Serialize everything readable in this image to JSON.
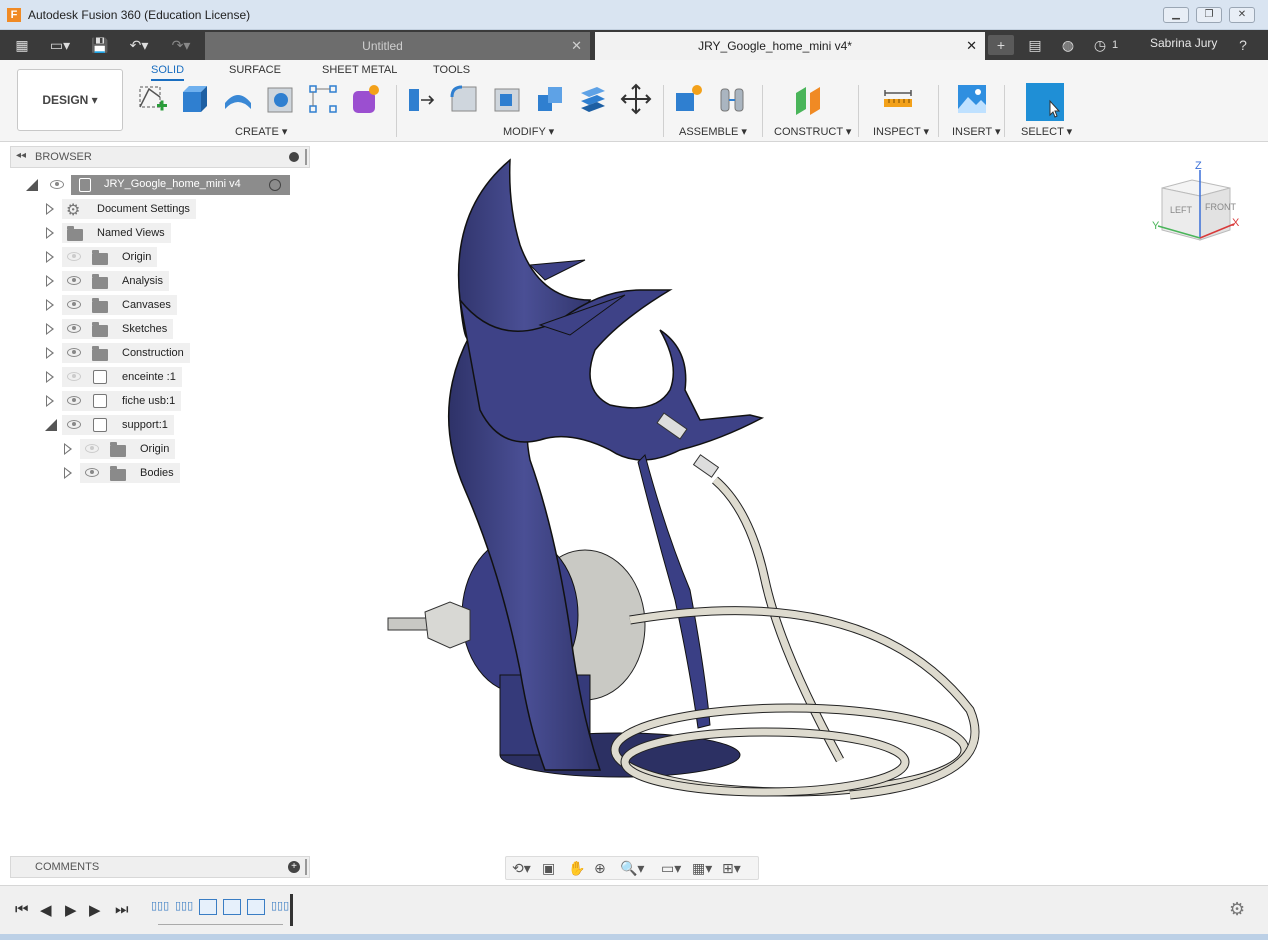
{
  "window": {
    "title": "Autodesk Fusion 360 (Education License)",
    "app_icon": "F"
  },
  "tabs": [
    {
      "label": "Untitled",
      "active": false
    },
    {
      "label": "JRY_Google_home_mini v4*",
      "active": true
    }
  ],
  "user": {
    "name": "Sabrina Jury",
    "jobs_count": "1"
  },
  "toolbar": {
    "workspace": "DESIGN",
    "workspace_tabs": [
      "SOLID",
      "SURFACE",
      "SHEET METAL",
      "TOOLS"
    ],
    "groups": [
      "CREATE",
      "MODIFY",
      "ASSEMBLE",
      "CONSTRUCT",
      "INSPECT",
      "INSERT",
      "SELECT"
    ]
  },
  "browser": {
    "title": "BROWSER",
    "root": "JRY_Google_home_mini v4",
    "items": [
      {
        "label": "Document Settings"
      },
      {
        "label": "Named Views"
      },
      {
        "label": "Origin"
      },
      {
        "label": "Analysis"
      },
      {
        "label": "Canvases"
      },
      {
        "label": "Sketches"
      },
      {
        "label": "Construction"
      },
      {
        "label": "enceinte :1"
      },
      {
        "label": "fiche usb:1"
      },
      {
        "label": "support:1"
      },
      {
        "label": "Origin"
      },
      {
        "label": "Bodies"
      }
    ]
  },
  "comments": {
    "title": "COMMENTS"
  },
  "viewcube": {
    "z": "Z",
    "x": "X",
    "y": "Y",
    "left": "LEFT",
    "front": "FRONT"
  },
  "colors": {
    "accent": "#1a6ec0",
    "model_body": "#3b3f7a",
    "cable": "#dedbcf"
  }
}
